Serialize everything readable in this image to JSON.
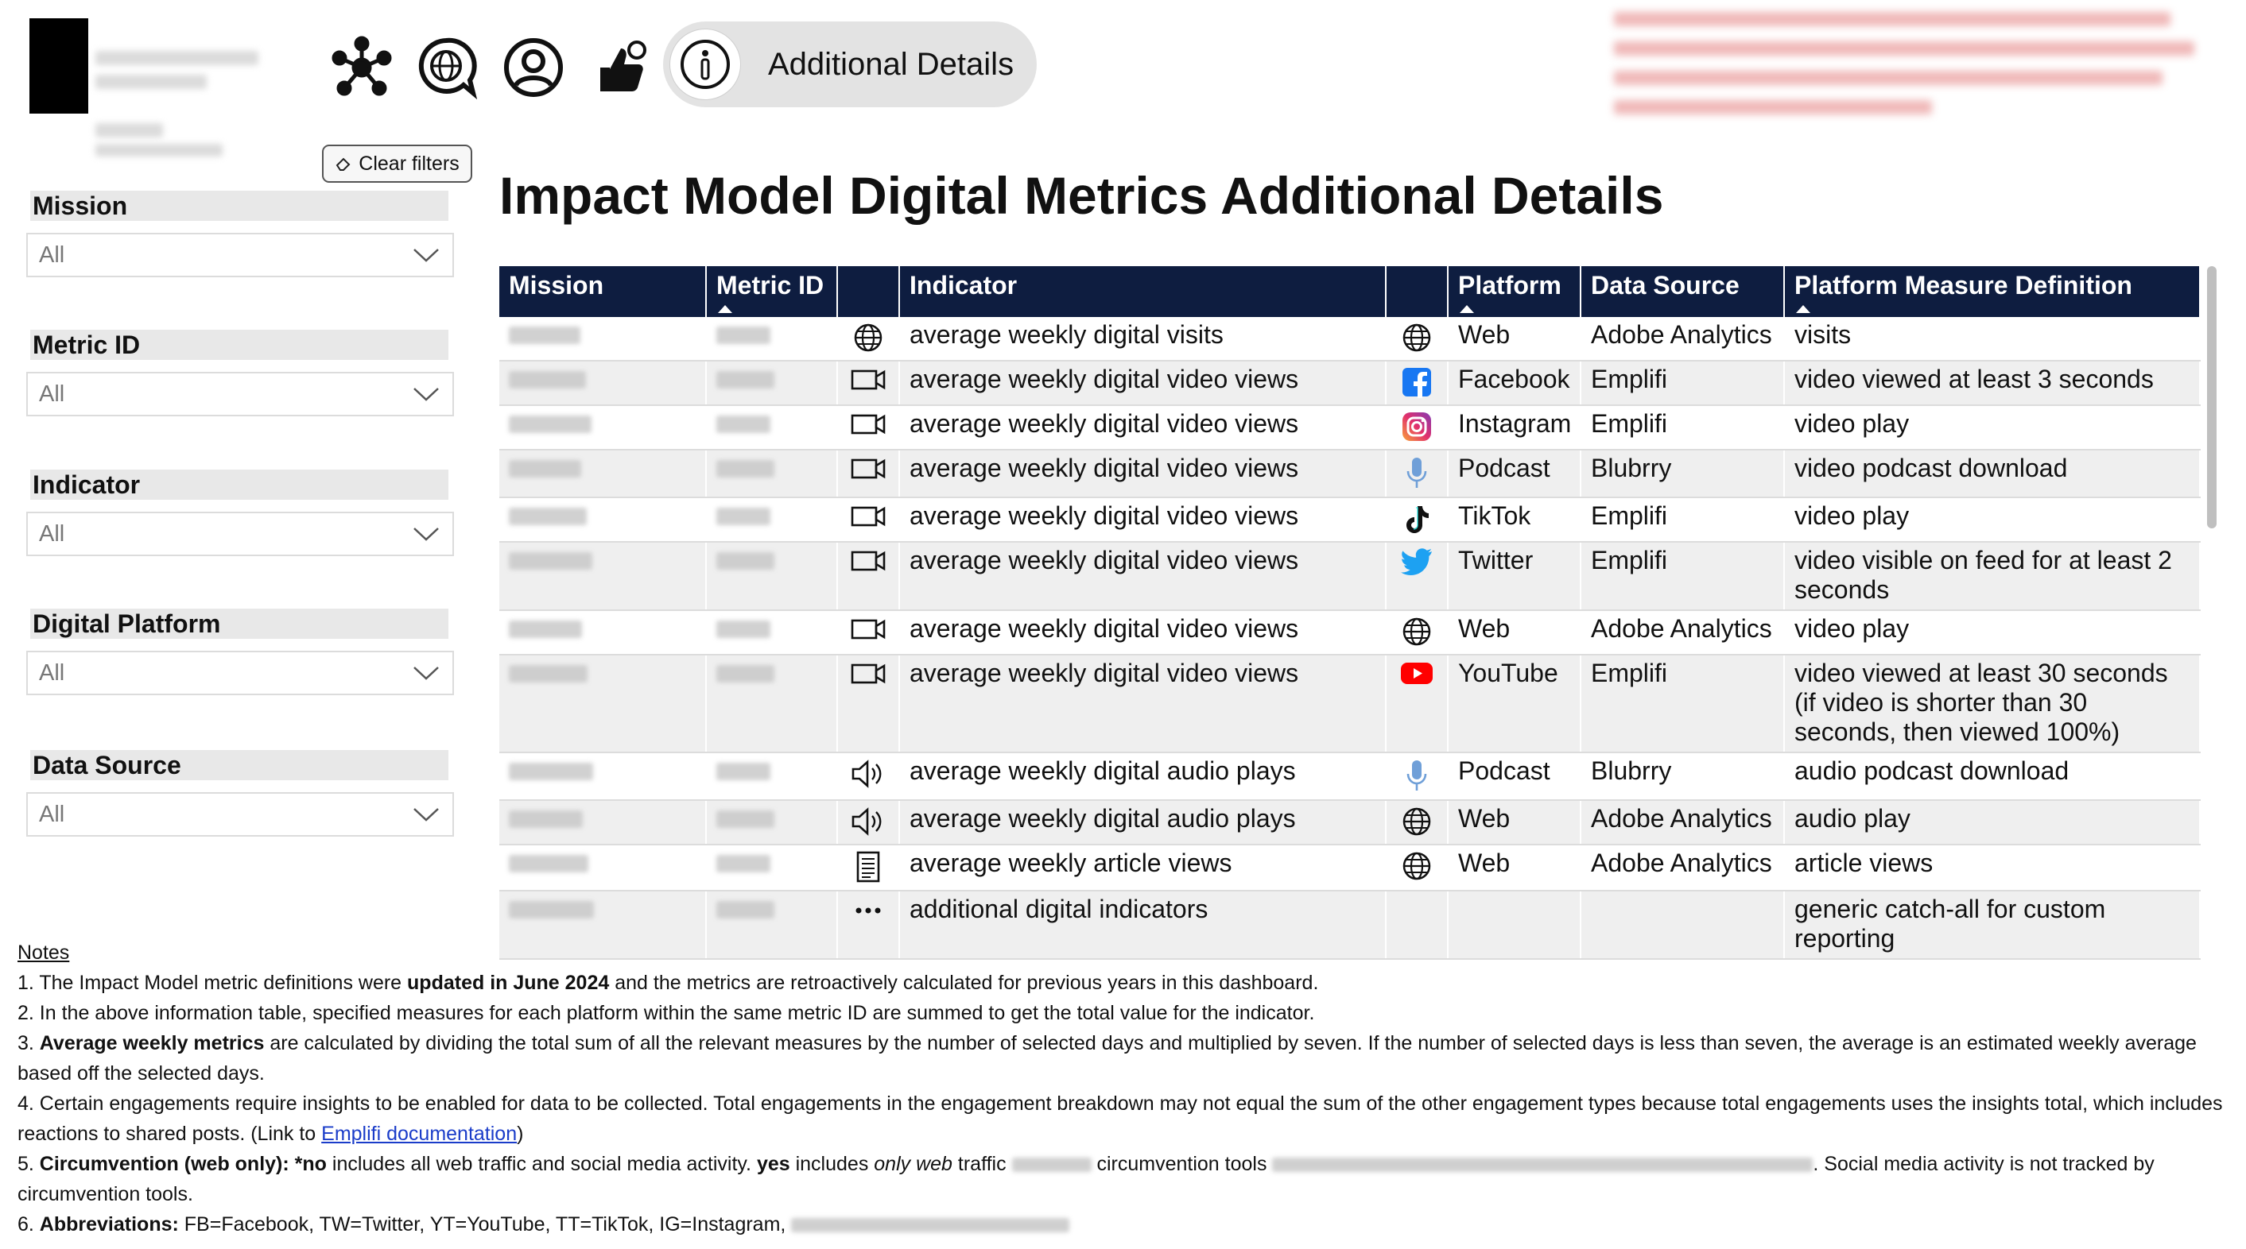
{
  "nav": {
    "active_tab_label": "Additional Details",
    "icons": [
      "network-icon",
      "globe-chat-icon",
      "user-icon",
      "thumbs-up-icon",
      "info-icon"
    ]
  },
  "filters": {
    "clear_label": "Clear filters",
    "items": [
      {
        "label": "Mission",
        "value": "All"
      },
      {
        "label": "Metric ID",
        "value": "All"
      },
      {
        "label": "Indicator",
        "value": "All"
      },
      {
        "label": "Digital Platform",
        "value": "All"
      },
      {
        "label": "Data Source",
        "value": "All"
      }
    ]
  },
  "page": {
    "title": "Impact Model Digital Metrics Additional Details"
  },
  "table": {
    "headers": [
      "Mission",
      "Metric ID",
      "",
      "Indicator",
      "",
      "Platform",
      "Data Source",
      "Platform Measure Definition"
    ],
    "rows": [
      {
        "indicator_icon": "globe-icon",
        "indicator": "average weekly digital visits",
        "platform_icon": "globe-icon",
        "platform": "Web",
        "source": "Adobe Analytics",
        "definition": "visits"
      },
      {
        "indicator_icon": "video-icon",
        "indicator": "average weekly digital video views",
        "platform_icon": "facebook-icon",
        "platform": "Facebook",
        "source": "Emplifi",
        "definition": "video viewed at least 3 seconds"
      },
      {
        "indicator_icon": "video-icon",
        "indicator": "average weekly digital video views",
        "platform_icon": "instagram-icon",
        "platform": "Instagram",
        "source": "Emplifi",
        "definition": "video play"
      },
      {
        "indicator_icon": "video-icon",
        "indicator": "average weekly digital video views",
        "platform_icon": "microphone-icon",
        "platform": "Podcast",
        "source": "Blubrry",
        "definition": "video podcast download"
      },
      {
        "indicator_icon": "video-icon",
        "indicator": "average weekly digital video views",
        "platform_icon": "tiktok-icon",
        "platform": "TikTok",
        "source": "Emplifi",
        "definition": "video play"
      },
      {
        "indicator_icon": "video-icon",
        "indicator": "average weekly digital video views",
        "platform_icon": "twitter-icon",
        "platform": "Twitter",
        "source": "Emplifi",
        "definition": "video visible on feed for at least 2 seconds"
      },
      {
        "indicator_icon": "video-icon",
        "indicator": "average weekly digital video views",
        "platform_icon": "globe-icon",
        "platform": "Web",
        "source": "Adobe Analytics",
        "definition": "video play"
      },
      {
        "indicator_icon": "video-icon",
        "indicator": "average weekly digital video views",
        "platform_icon": "youtube-icon",
        "platform": "YouTube",
        "source": "Emplifi",
        "definition": "video viewed at least 30 seconds (if video is shorter than 30 seconds, then viewed 100%)"
      },
      {
        "indicator_icon": "speaker-icon",
        "indicator": "average weekly digital audio plays",
        "platform_icon": "microphone-icon",
        "platform": "Podcast",
        "source": "Blubrry",
        "definition": "audio podcast download"
      },
      {
        "indicator_icon": "speaker-icon",
        "indicator": "average weekly digital audio plays",
        "platform_icon": "globe-icon",
        "platform": "Web",
        "source": "Adobe Analytics",
        "definition": "audio play"
      },
      {
        "indicator_icon": "article-icon",
        "indicator": "average weekly article views",
        "platform_icon": "globe-icon",
        "platform": "Web",
        "source": "Adobe Analytics",
        "definition": "article views"
      },
      {
        "indicator_icon": "ellipsis-icon",
        "indicator": "additional digital indicators",
        "platform_icon": "",
        "platform": "",
        "source": "",
        "definition": "generic catch-all for custom reporting"
      }
    ]
  },
  "notes": {
    "header": "Notes",
    "n1_a": "1. The Impact Model metric definitions were ",
    "n1_b": "updated in June 2024",
    "n1_c": " and the metrics are retroactively calculated for previous years in this dashboard.",
    "n2": "2. In the above information table, specified measures for each platform within the same metric ID are summed to get the total value for the indicator.",
    "n3_a": "3. ",
    "n3_b": "Average weekly metrics",
    "n3_c": " are calculated by dividing the total sum of all the relevant measures by the number of selected days and multiplied by seven. If the number of selected days is less than seven, the average is an estimated weekly average based off the selected days.",
    "n4_a": "4. Certain engagements require insights to be enabled for data to be collected. Total engagements in the engagement breakdown may not equal the sum of the other engagement types because total engagements uses the insights total, which includes reactions to shared posts. (Link to ",
    "n4_link": "Emplifi documentation",
    "n4_c": ")",
    "n5_a": "5. ",
    "n5_b": "Circumvention (web only): ",
    "n5_c": "*no",
    "n5_d": " includes all web traffic and social media activity. ",
    "n5_e": "yes",
    "n5_f": " includes ",
    "n5_g": "only web",
    "n5_h": " traffic ",
    "n5_i": " circumvention tools ",
    "n5_j": ". Social media activity is not tracked by circumvention tools.",
    "n6_a": "6. ",
    "n6_b": "Abbreviations:",
    "n6_c": " FB=Facebook, TW=Twitter, YT=YouTube, TT=TikTok, IG=Instagram, "
  }
}
